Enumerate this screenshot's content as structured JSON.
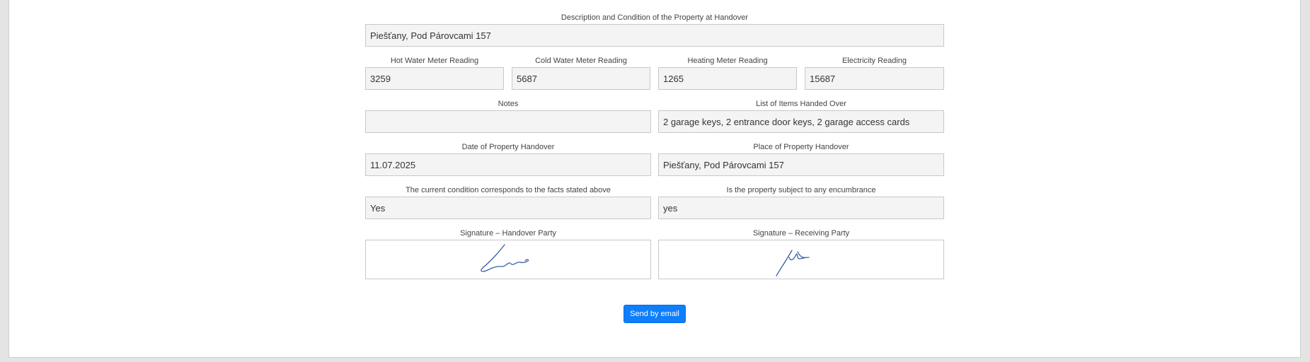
{
  "form": {
    "description": {
      "label": "Description and Condition of the Property at Handover",
      "value": "Piešťany, Pod Párovcami 157"
    },
    "meters": [
      {
        "label": "Hot Water Meter Reading",
        "value": "3259"
      },
      {
        "label": "Cold Water Meter Reading",
        "value": "5687"
      },
      {
        "label": "Heating Meter Reading",
        "value": "1265"
      },
      {
        "label": "Electricity Reading",
        "value": "15687"
      }
    ],
    "notes": {
      "label": "Notes",
      "value": ""
    },
    "items_handed_over": {
      "label": "List of Items Handed Over",
      "value": "2 garage keys, 2 entrance door keys, 2 garage access cards"
    },
    "handover_date": {
      "label": "Date of Property Handover",
      "value": "11.07.2025"
    },
    "handover_place": {
      "label": "Place of Property Handover",
      "value": "Piešťany, Pod Párovcami 157"
    },
    "condition_matches": {
      "label": "The current condition corresponds to the facts stated above",
      "value": "Yes"
    },
    "encumbrance": {
      "label": "Is the property subject to any encumbrance",
      "value": "yes"
    },
    "signature_handover": {
      "label": "Signature – Handover Party"
    },
    "signature_receiving": {
      "label": "Signature – Receiving Party"
    }
  },
  "actions": {
    "send_email_label": "Send by email"
  },
  "colors": {
    "primary_button": "#0d7efc",
    "input_background": "#f4f4f4",
    "signature_ink": "#3a5fa8"
  }
}
